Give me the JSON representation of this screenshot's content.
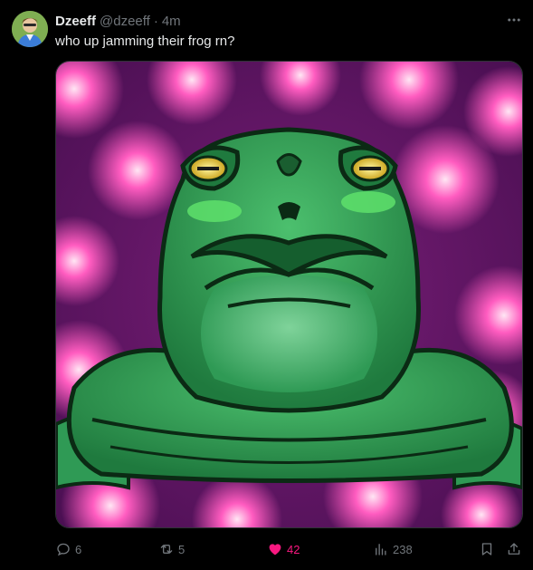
{
  "author": {
    "display_name": "Dzeeff",
    "handle": "@dzeeff",
    "separator": "·",
    "time": "4m"
  },
  "tweet": {
    "text": "who up jamming their frog rn?"
  },
  "actions": {
    "replies": "6",
    "retweets": "5",
    "likes": "42",
    "views": "238",
    "liked": true
  },
  "colors": {
    "background": "#000000",
    "text": "#e7e9ea",
    "muted": "#71767b",
    "like": "#f91880",
    "border": "#2f3336"
  },
  "icons": [
    "avatar",
    "more-icon",
    "reply-icon",
    "retweet-icon",
    "like-icon",
    "views-icon",
    "bookmark-icon",
    "share-icon"
  ]
}
